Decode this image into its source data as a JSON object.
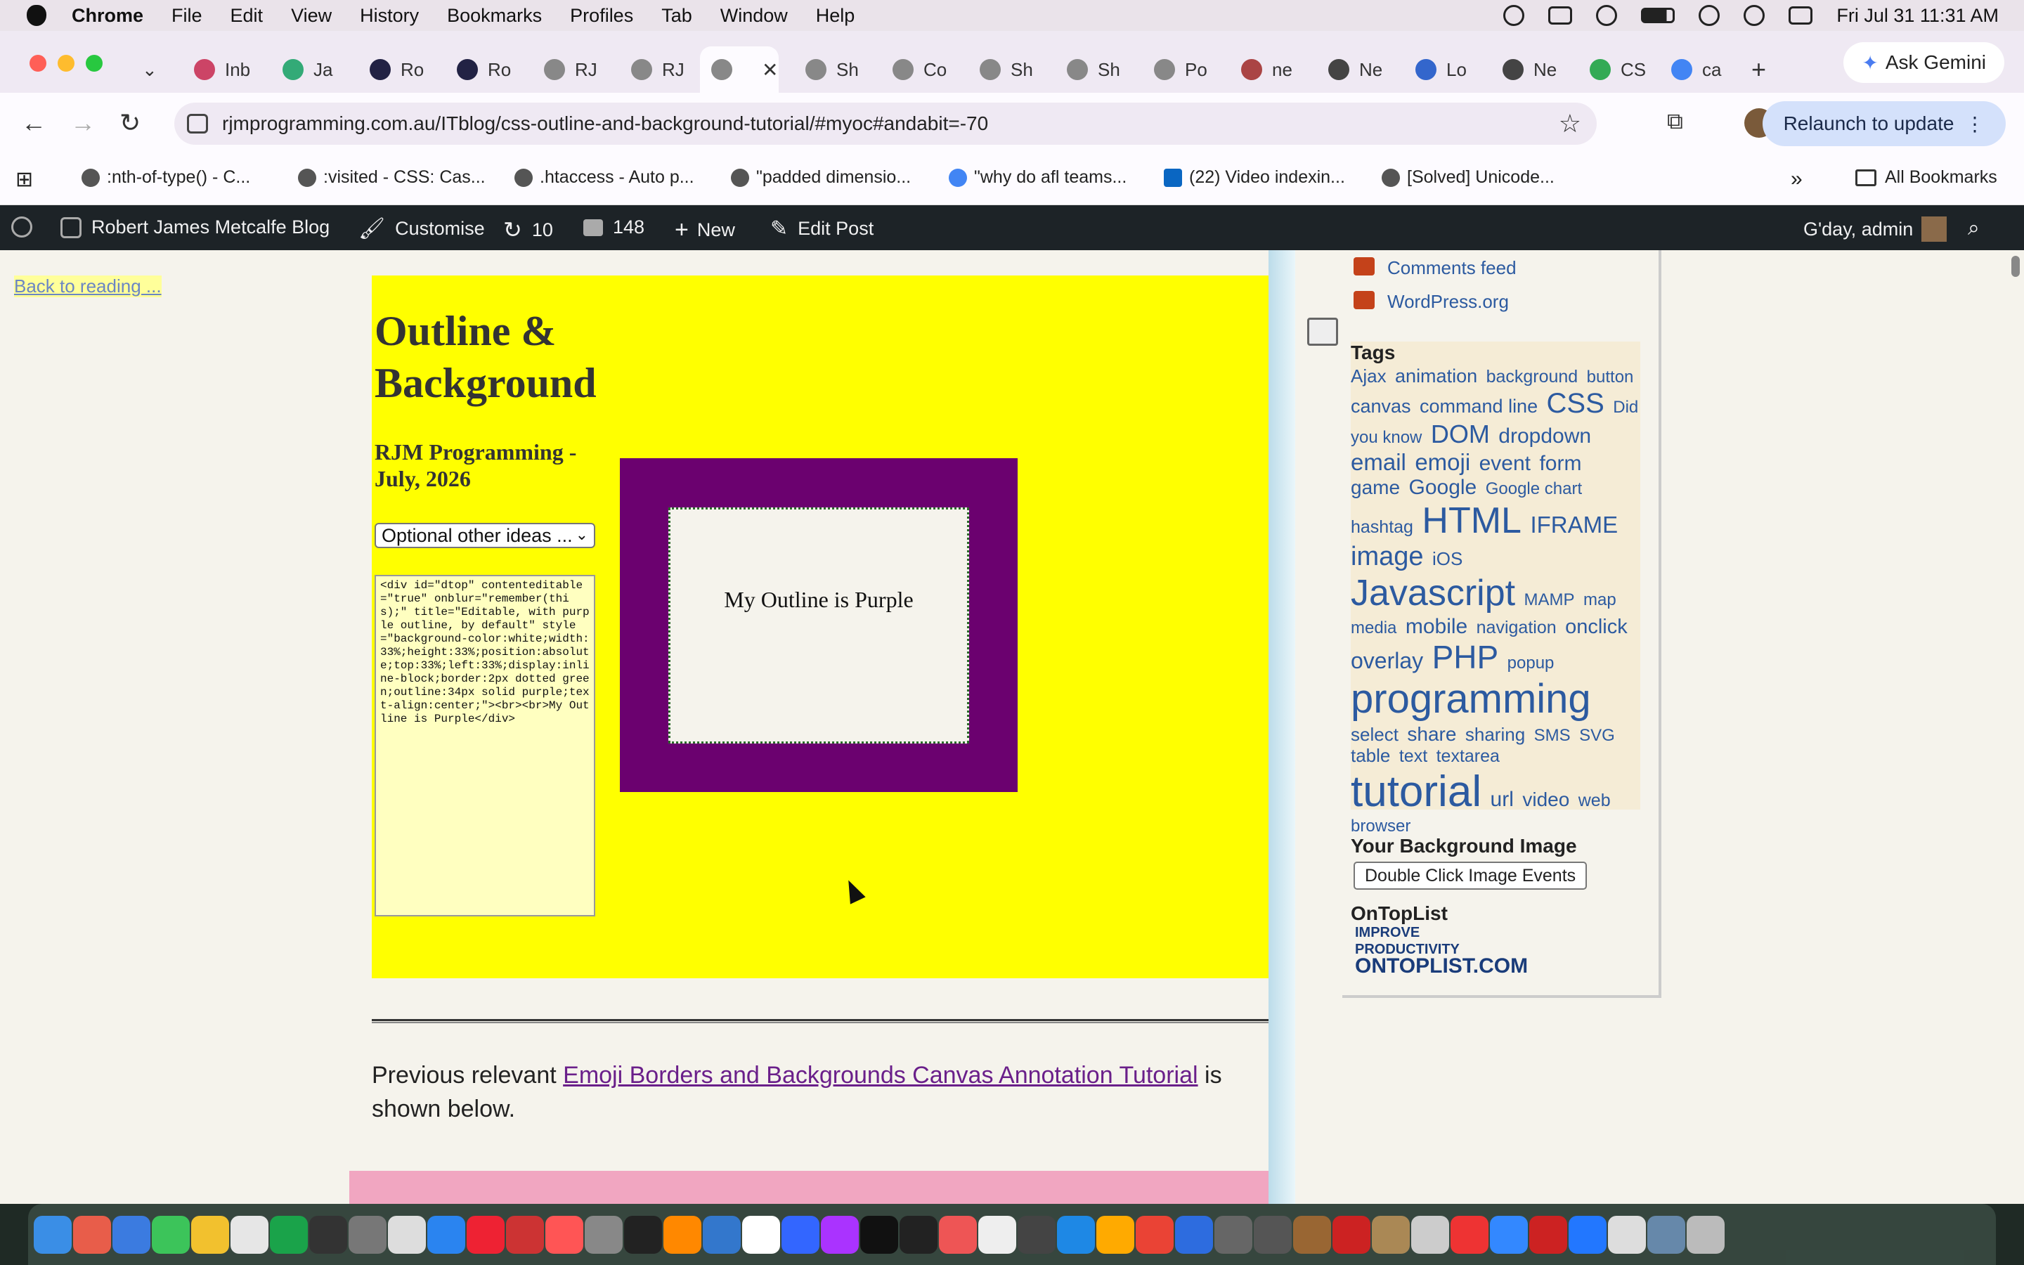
{
  "menubar": {
    "app": "Chrome",
    "items": [
      "File",
      "Edit",
      "View",
      "History",
      "Bookmarks",
      "Profiles",
      "Tab",
      "Window",
      "Help"
    ],
    "clock": "Fri Jul 31  11:31 AM"
  },
  "tabs": {
    "labels": [
      "Inb",
      "Ja",
      "Ro",
      "Ro",
      "RJ",
      "RJ",
      "",
      "Sh",
      "Co",
      "Sh",
      "Sh",
      "Po",
      "ne",
      "Ne",
      "Lo",
      "Ne",
      "CS",
      "ca"
    ],
    "active_index": 6,
    "ask_gemini": "Ask Gemini"
  },
  "toolbar": {
    "url": "rjmprogramming.com.au/ITblog/css-outline-and-background-tutorial/#myoc#andabit=-70",
    "relaunch": "Relaunch to update"
  },
  "bookmarks": {
    "items": [
      ":nth-of-type() - C...",
      ":visited - CSS: Cas...",
      ".htaccess - Auto p...",
      "\"padded dimensio...",
      "\"why do afl teams...",
      "(22) Video indexin...",
      "[Solved] Unicode..."
    ],
    "more": "»",
    "all": "All Bookmarks"
  },
  "wpbar": {
    "site": "Robert James Metcalfe Blog",
    "customise": "Customise",
    "updates": "10",
    "comments": "148",
    "new": "New",
    "edit": "Edit Post",
    "greeting": "G'day, admin"
  },
  "content": {
    "back_link": "Back to reading ...",
    "title": "Outline & Background",
    "subtitle": "RJM Programming - July, 2026",
    "select_value": "Optional other ideas ...",
    "code": "<div id=\"dtop\" contenteditable=\"true\" onblur=\"remember(this);\" title=\"Editable, with purple outline, by default\" style=\"background-color:white;width:33%;height:33%;position:absolute;top:33%;left:33%;display:inline-block;border:2px dotted green;outline:34px solid purple;text-align:center;\"><br><br>My Outline is Purple</div>",
    "demo_text": "My Outline is Purple",
    "prev_text_1": "Previous relevant ",
    "prev_link": "Emoji Borders and Backgrounds Canvas Annotation Tutorial",
    "prev_text_2": " is shown below."
  },
  "sidebar": {
    "links": [
      "Comments feed",
      "WordPress.org"
    ],
    "tags_heading": "Tags",
    "tags": [
      {
        "t": "Ajax",
        "s": 26
      },
      {
        "t": "animation",
        "s": 27
      },
      {
        "t": "background",
        "s": 25
      },
      {
        "t": "button",
        "s": 24
      },
      {
        "t": "canvas",
        "s": 27
      },
      {
        "t": "command line",
        "s": 27
      },
      {
        "t": "CSS",
        "s": 40
      },
      {
        "t": "Did you know",
        "s": 24
      },
      {
        "t": "DOM",
        "s": 36
      },
      {
        "t": "dropdown",
        "s": 30
      },
      {
        "t": "email",
        "s": 33
      },
      {
        "t": "emoji",
        "s": 33
      },
      {
        "t": "event",
        "s": 30
      },
      {
        "t": "form",
        "s": 30
      },
      {
        "t": "game",
        "s": 28
      },
      {
        "t": "Google",
        "s": 30
      },
      {
        "t": "Google chart",
        "s": 24
      },
      {
        "t": "hashtag",
        "s": 25
      },
      {
        "t": "HTML",
        "s": 52
      },
      {
        "t": "IFRAME",
        "s": 33
      },
      {
        "t": "image",
        "s": 38
      },
      {
        "t": "iOS",
        "s": 26
      },
      {
        "t": "Javascript",
        "s": 52
      },
      {
        "t": "MAMP",
        "s": 24
      },
      {
        "t": "map",
        "s": 24
      },
      {
        "t": "media",
        "s": 24
      },
      {
        "t": "mobile",
        "s": 30
      },
      {
        "t": "navigation",
        "s": 25
      },
      {
        "t": "onclick",
        "s": 29
      },
      {
        "t": "overlay",
        "s": 32
      },
      {
        "t": "PHP",
        "s": 46
      },
      {
        "t": "popup",
        "s": 24
      },
      {
        "t": "programming",
        "s": 58
      },
      {
        "t": "select",
        "s": 26
      },
      {
        "t": "share",
        "s": 28
      },
      {
        "t": "sharing",
        "s": 26
      },
      {
        "t": "SMS",
        "s": 24
      },
      {
        "t": "SVG",
        "s": 24
      },
      {
        "t": "table",
        "s": 26
      },
      {
        "t": "text",
        "s": 25
      },
      {
        "t": "textarea",
        "s": 25
      },
      {
        "t": "tutorial",
        "s": 62
      },
      {
        "t": "url",
        "s": 30
      },
      {
        "t": "video",
        "s": 28
      },
      {
        "t": "web",
        "s": 25
      },
      {
        "t": "browser",
        "s": 24
      }
    ],
    "bg_heading": "Your Background Image",
    "bg_button": "Double Click Image Events",
    "otl_heading": "OnTopList",
    "otl_line1": "IMPROVE PRODUCTIVITY",
    "otl_line2": "ONTOPLIST.COM"
  },
  "colors": {
    "yellow": "#ffff00",
    "purple": "#6b016f",
    "wp_bar": "#1d2327",
    "link": "#2c5aa0"
  }
}
